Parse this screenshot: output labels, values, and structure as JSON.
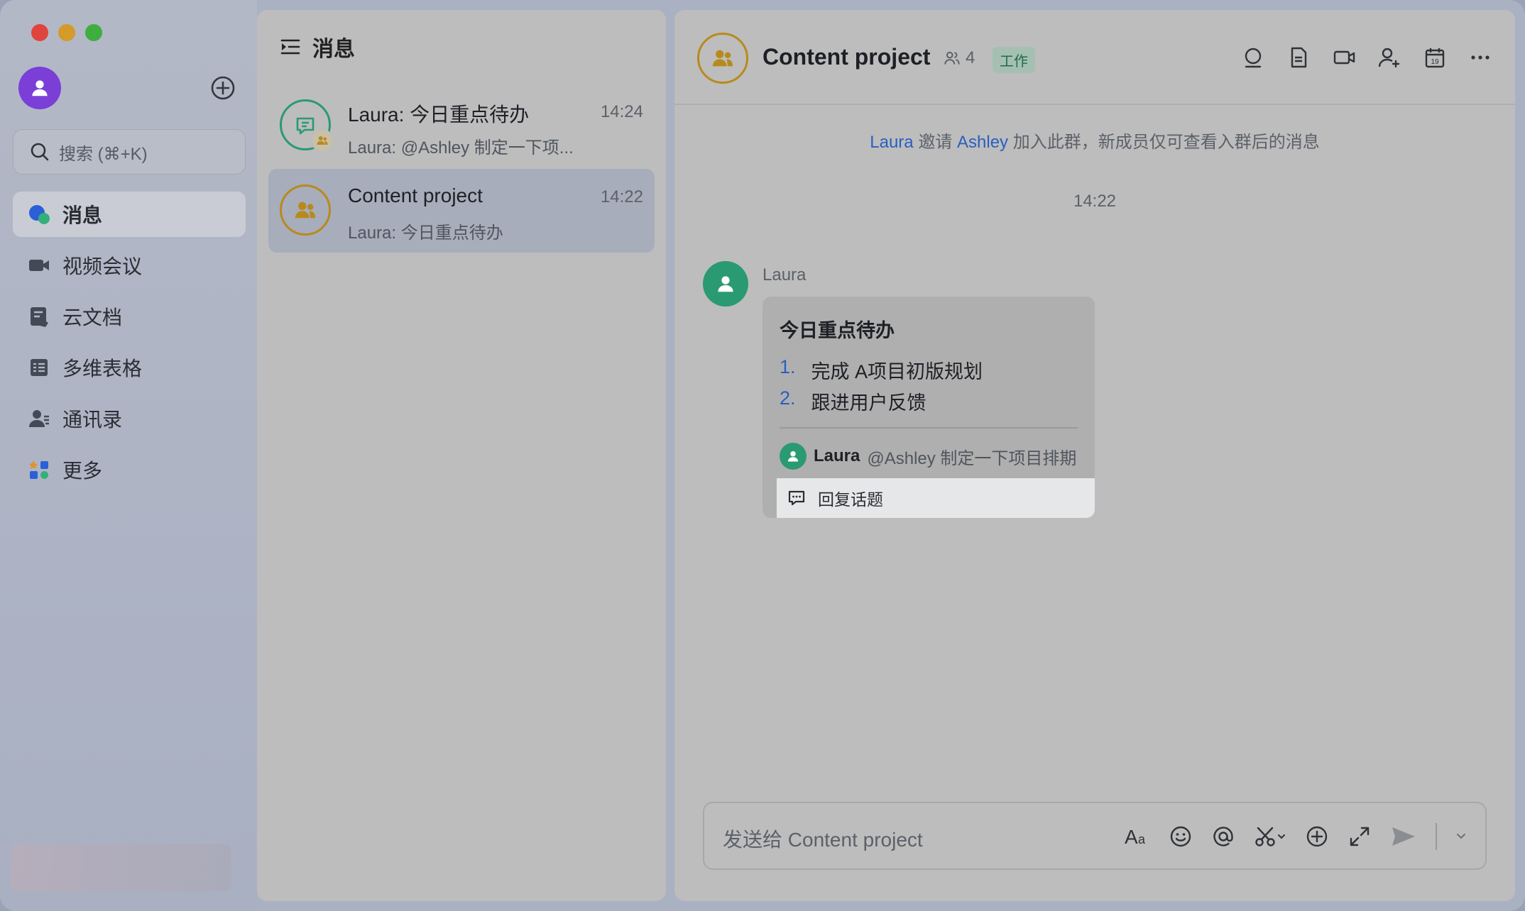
{
  "sidebar": {
    "search_placeholder": "搜索 (⌘+K)",
    "items": [
      {
        "label": "消息",
        "icon": "messages-icon",
        "active": true
      },
      {
        "label": "视频会议",
        "icon": "video-meeting-icon",
        "active": false
      },
      {
        "label": "云文档",
        "icon": "cloud-docs-icon",
        "active": false
      },
      {
        "label": "多维表格",
        "icon": "base-table-icon",
        "active": false
      },
      {
        "label": "通讯录",
        "icon": "contacts-icon",
        "active": false
      },
      {
        "label": "更多",
        "icon": "more-apps-icon",
        "active": false
      }
    ]
  },
  "list": {
    "header": "消息",
    "conversations": [
      {
        "title": "Laura: 今日重点待办",
        "time": "14:24",
        "preview": "Laura: @Ashley 制定一下项...",
        "active": false
      },
      {
        "title": "Content project",
        "time": "14:22",
        "preview": "Laura: 今日重点待办",
        "active": true
      }
    ]
  },
  "chat": {
    "title": "Content project",
    "member_count": "4",
    "tag": "工作",
    "system_message": {
      "inviter": "Laura",
      "action": "邀请",
      "invitee": "Ashley",
      "rest": "加入此群，新成员仅可查看入群后的消息"
    },
    "timestamp": "14:22",
    "message": {
      "sender": "Laura",
      "card_title": "今日重点待办",
      "items": [
        {
          "num": "1.",
          "text": "完成 A项目初版规划"
        },
        {
          "num": "2.",
          "text": "跟进用户反馈"
        }
      ],
      "quote_name": "Laura",
      "quote_text": "@Ashley 制定一下项目排期",
      "reply_label": "回复话题"
    },
    "composer_placeholder": "发送给 Content project"
  },
  "colors": {
    "accent_blue": "#2a5fbf",
    "green_avatar": "#2a9a72",
    "gold_border": "#b88a1e",
    "purple_avatar": "#7b3fd8"
  }
}
